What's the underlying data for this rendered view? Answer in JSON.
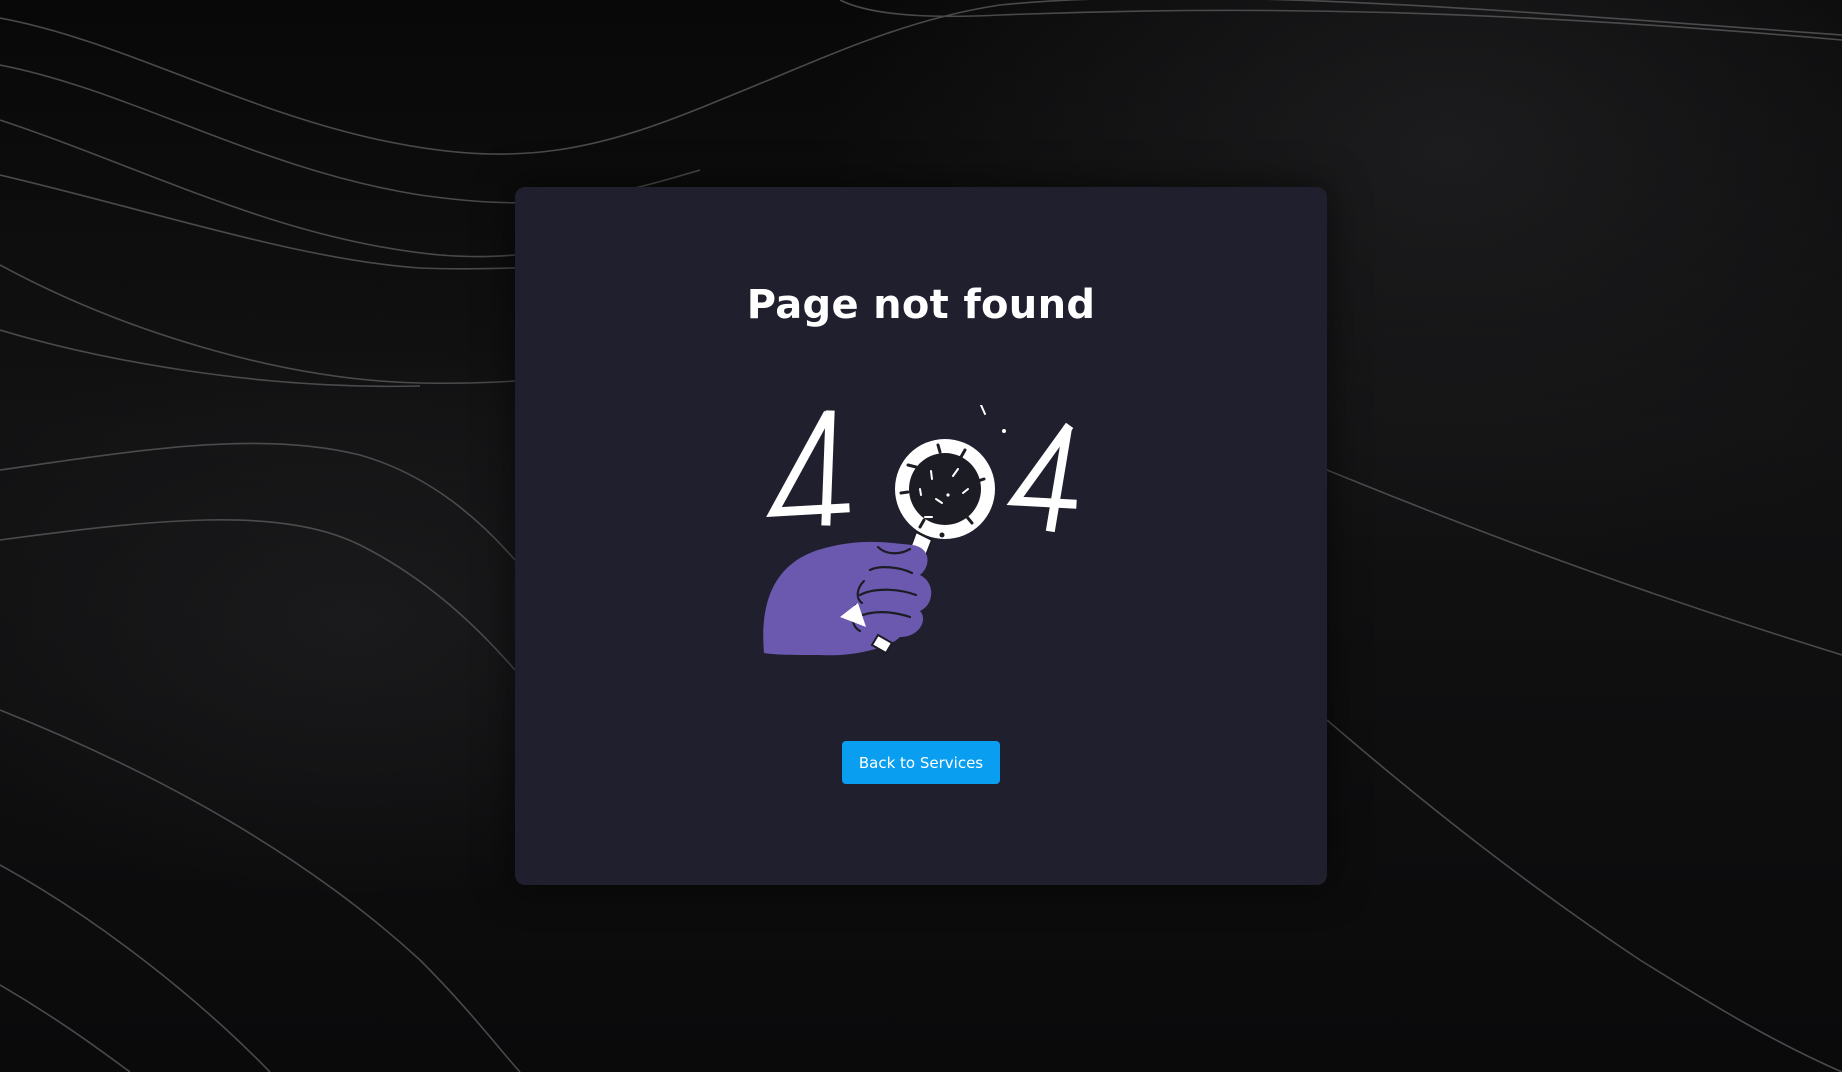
{
  "page": {
    "title": "Page not found",
    "button_label": "Back to Services"
  },
  "illustration": {
    "digits": [
      "4",
      "4"
    ],
    "icon": "magnifying-glass-in-hand-icon"
  },
  "colors": {
    "card_background": "#1f1f2e",
    "button_background": "#0a9ef0",
    "hand": "#6b59b0",
    "text": "#ffffff"
  }
}
